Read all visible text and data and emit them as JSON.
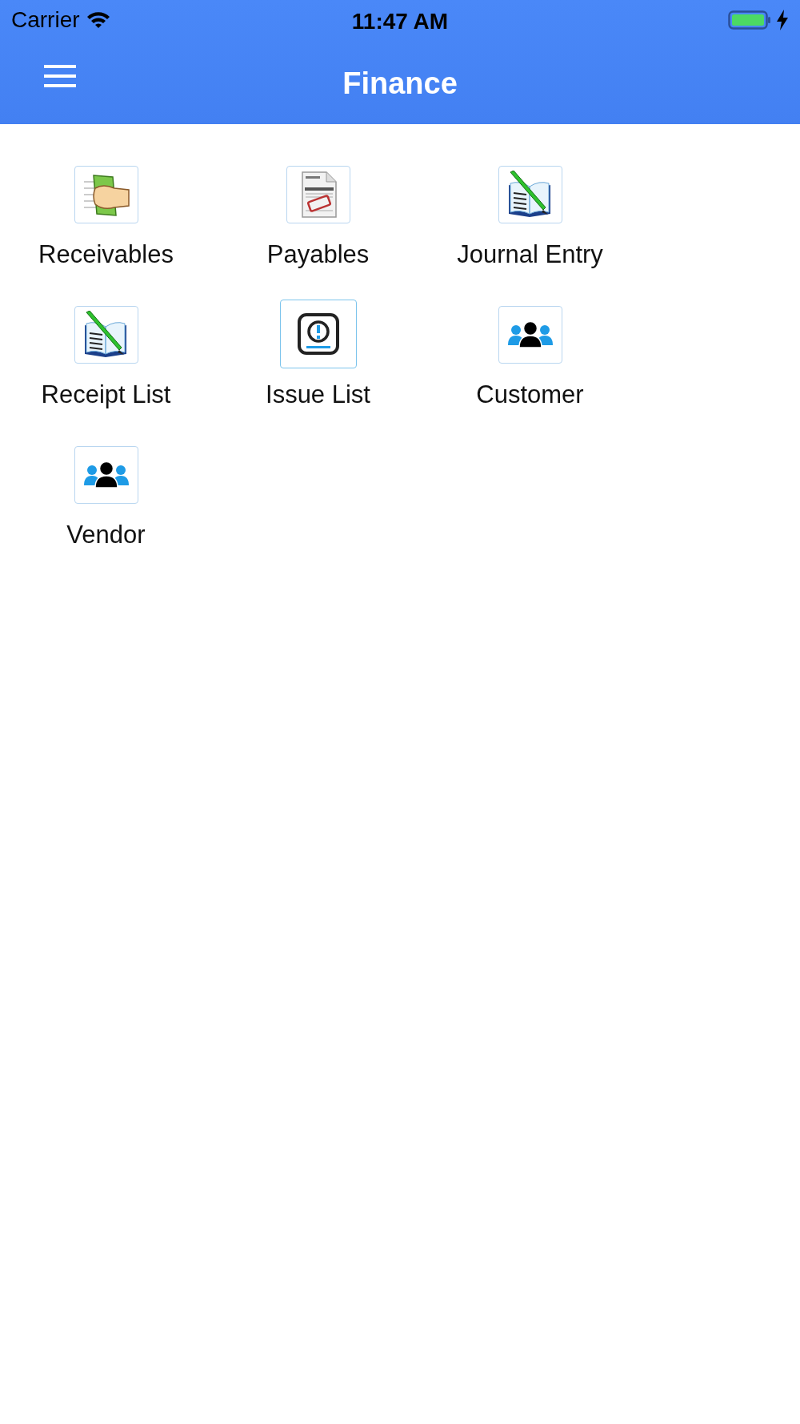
{
  "status_bar": {
    "carrier": "Carrier",
    "time": "11:47 AM"
  },
  "navbar": {
    "title": "Finance"
  },
  "items": [
    {
      "label": "Receivables",
      "kind": "money"
    },
    {
      "label": "Payables",
      "kind": "invoice"
    },
    {
      "label": "Journal Entry",
      "kind": "book"
    },
    {
      "label": "Receipt List",
      "kind": "book"
    },
    {
      "label": "Issue List",
      "kind": "alert"
    },
    {
      "label": "Customer",
      "kind": "group"
    },
    {
      "label": "Vendor",
      "kind": "group"
    }
  ]
}
